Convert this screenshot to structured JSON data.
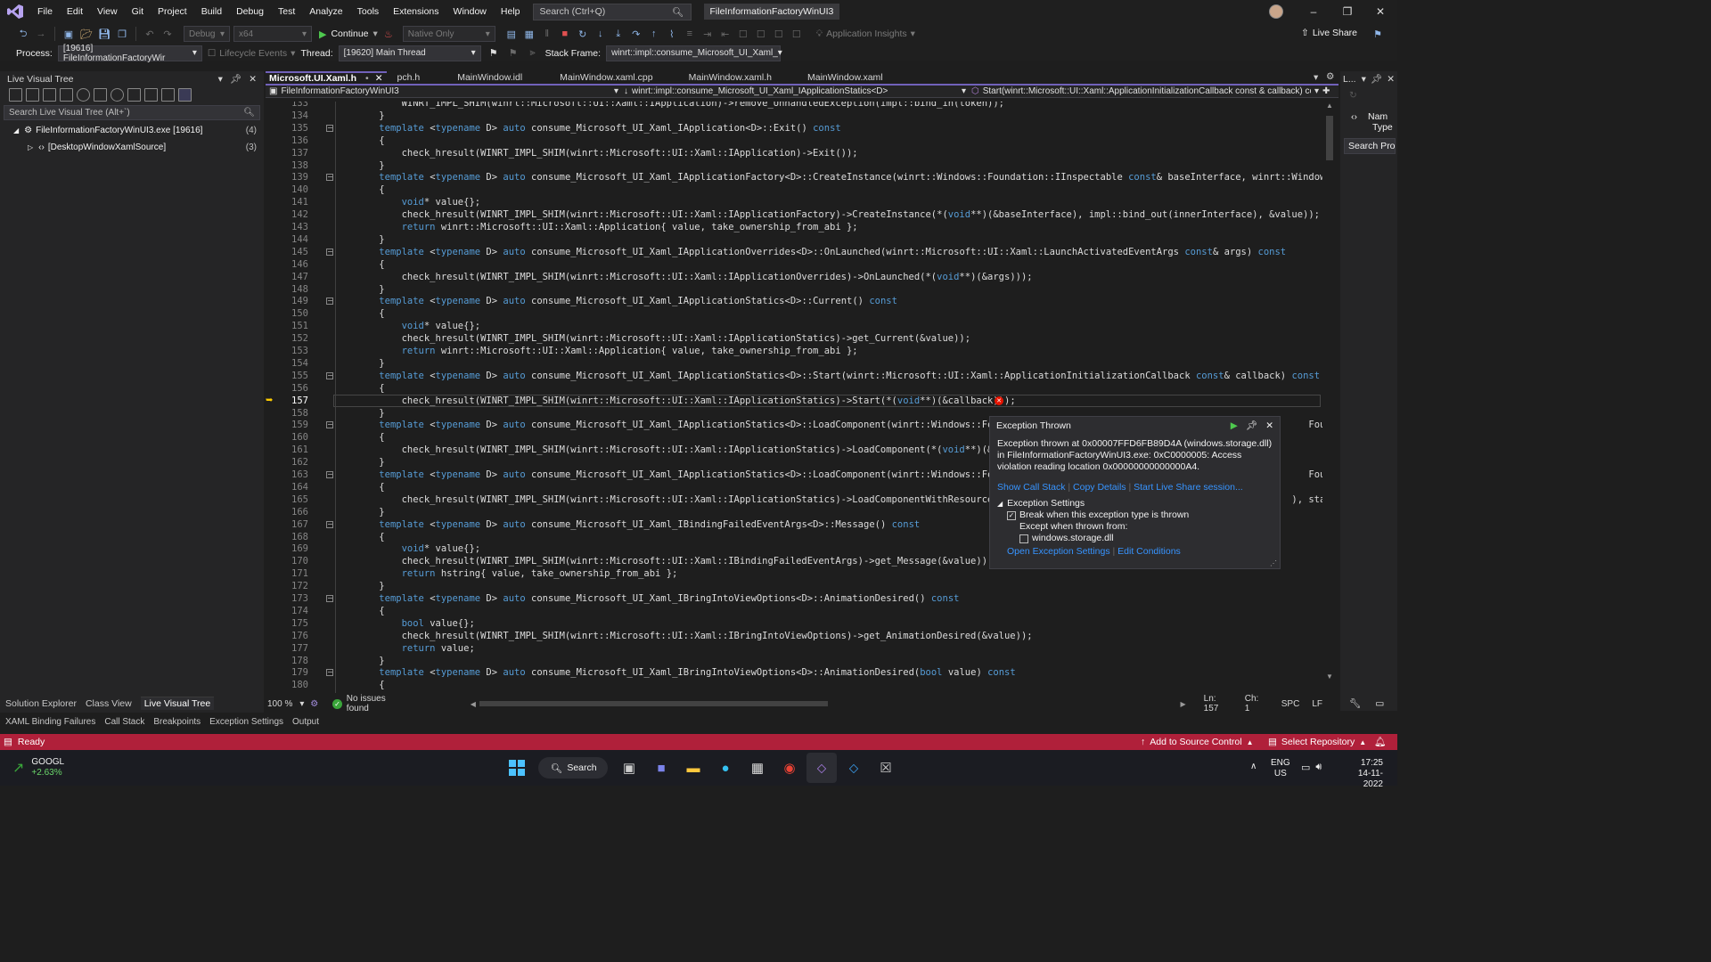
{
  "menubar": {
    "items": [
      "File",
      "Edit",
      "View",
      "Git",
      "Project",
      "Build",
      "Debug",
      "Test",
      "Analyze",
      "Tools",
      "Extensions",
      "Window",
      "Help"
    ],
    "search_placeholder": "Search (Ctrl+Q)",
    "solution_title": "FileInformationFactoryWinUI3"
  },
  "toolbar": {
    "config": "Debug",
    "platform": "x64",
    "continue_label": "Continue",
    "debugger_type": "Native Only",
    "app_insights": "Application Insights",
    "live_share": "Live Share"
  },
  "debugbar": {
    "process_label": "Process:",
    "process_value": "[19616] FileInformationFactoryWir",
    "lifecycle": "Lifecycle Events",
    "thread_label": "Thread:",
    "thread_value": "[19620] Main Thread",
    "stack_label": "Stack Frame:",
    "stack_value": "winrt::impl::consume_Microsoft_UI_Xaml_"
  },
  "live_tree": {
    "title": "Live Visual Tree",
    "search_placeholder": "Search Live Visual Tree (Alt+`)",
    "nodes": [
      {
        "label": "FileInformationFactoryWinUI3.exe [19616]",
        "count": "(4)"
      },
      {
        "label": "[DesktopWindowXamlSource]",
        "count": "(3)"
      }
    ],
    "bottom_tabs": [
      "Solution Explorer",
      "Class View",
      "Live Visual Tree"
    ]
  },
  "editor": {
    "tabs": [
      "Microsoft.UI.Xaml.h",
      "pch.h",
      "MainWindow.idl",
      "MainWindow.xaml.cpp",
      "MainWindow.xaml.h",
      "MainWindow.xaml"
    ],
    "nav_project": "FileInformationFactoryWinUI3",
    "nav_scope": "winrt::impl::consume_Microsoft_UI_Xaml_IApplicationStatics<D>",
    "nav_member": "Start(winrt::Microsoft::UI::Xaml::ApplicationInitializationCallback const & callback) cc",
    "zoom": "100 %",
    "issues": "No issues found",
    "position": {
      "ln": "Ln: 157",
      "ch": "Ch: 1",
      "spc": "SPC",
      "lf": "LF"
    },
    "current_line": 157,
    "lines": [
      {
        "n": "133",
        "t": "        WINRT_IMPL_SHIM(winrt::Microsoft::UI::Xaml::IApplication)->remove_UnhandledException(impl::bind_in(token));"
      },
      {
        "n": "134",
        "t": "    }"
      },
      {
        "n": "135",
        "t": "    template <typename D> auto consume_Microsoft_UI_Xaml_IApplication<D>::Exit() const"
      },
      {
        "n": "136",
        "t": "    {"
      },
      {
        "n": "137",
        "t": "        check_hresult(WINRT_IMPL_SHIM(winrt::Microsoft::UI::Xaml::IApplication)->Exit());"
      },
      {
        "n": "138",
        "t": "    }"
      },
      {
        "n": "139",
        "t": "    template <typename D> auto consume_Microsoft_UI_Xaml_IApplicationFactory<D>::CreateInstance(winrt::Windows::Foundation::IInspectable const& baseInterface, winrt::Windows::Fou"
      },
      {
        "n": "140",
        "t": "    {"
      },
      {
        "n": "141",
        "t": "        void* value{};"
      },
      {
        "n": "142",
        "t": "        check_hresult(WINRT_IMPL_SHIM(winrt::Microsoft::UI::Xaml::IApplicationFactory)->CreateInstance(*(void**)(&baseInterface), impl::bind_out(innerInterface), &value));"
      },
      {
        "n": "143",
        "t": "        return winrt::Microsoft::UI::Xaml::Application{ value, take_ownership_from_abi };"
      },
      {
        "n": "144",
        "t": "    }"
      },
      {
        "n": "145",
        "t": "    template <typename D> auto consume_Microsoft_UI_Xaml_IApplicationOverrides<D>::OnLaunched(winrt::Microsoft::UI::Xaml::LaunchActivatedEventArgs const& args) const"
      },
      {
        "n": "146",
        "t": "    {"
      },
      {
        "n": "147",
        "t": "        check_hresult(WINRT_IMPL_SHIM(winrt::Microsoft::UI::Xaml::IApplicationOverrides)->OnLaunched(*(void**)(&args)));"
      },
      {
        "n": "148",
        "t": "    }"
      },
      {
        "n": "149",
        "t": "    template <typename D> auto consume_Microsoft_UI_Xaml_IApplicationStatics<D>::Current() const"
      },
      {
        "n": "150",
        "t": "    {"
      },
      {
        "n": "151",
        "t": "        void* value{};"
      },
      {
        "n": "152",
        "t": "        check_hresult(WINRT_IMPL_SHIM(winrt::Microsoft::UI::Xaml::IApplicationStatics)->get_Current(&value));"
      },
      {
        "n": "153",
        "t": "        return winrt::Microsoft::UI::Xaml::Application{ value, take_ownership_from_abi };"
      },
      {
        "n": "154",
        "t": "    }"
      },
      {
        "n": "155",
        "t": "    template <typename D> auto consume_Microsoft_UI_Xaml_IApplicationStatics<D>::Start(winrt::Microsoft::UI::Xaml::ApplicationInitializationCallback const& callback) const"
      },
      {
        "n": "156",
        "t": "    {"
      },
      {
        "n": "157",
        "t": "        check_hresult(WINRT_IMPL_SHIM(winrt::Microsoft::UI::Xaml::IApplicationStatics)->Start(*(void**)(&callback)));"
      },
      {
        "n": "158",
        "t": "    }"
      },
      {
        "n": "159",
        "t": "    template <typename D> auto consume_Microsoft_UI_Xaml_IApplicationStatics<D>::LoadComponent(winrt::Windows::Foundat                                                   Foundati"
      },
      {
        "n": "160",
        "t": "    {"
      },
      {
        "n": "161",
        "t": "        check_hresult(WINRT_IMPL_SHIM(winrt::Microsoft::UI::Xaml::IApplicationStatics)->LoadComponent(*(void**)(&compo"
      },
      {
        "n": "162",
        "t": "    }"
      },
      {
        "n": "163",
        "t": "    template <typename D> auto consume_Microsoft_UI_Xaml_IApplicationStatics<D>::LoadComponent(winrt::Windows::Foundat                                                   Foundati"
      },
      {
        "n": "164",
        "t": "    {"
      },
      {
        "n": "165",
        "t": "        check_hresult(WINRT_IMPL_SHIM(winrt::Microsoft::UI::Xaml::IApplicationStatics)->LoadComponentWithResourceLocat                                                ), stat"
      },
      {
        "n": "166",
        "t": "    }"
      },
      {
        "n": "167",
        "t": "    template <typename D> auto consume_Microsoft_UI_Xaml_IBindingFailedEventArgs<D>::Message() const"
      },
      {
        "n": "168",
        "t": "    {"
      },
      {
        "n": "169",
        "t": "        void* value{};"
      },
      {
        "n": "170",
        "t": "        check_hresult(WINRT_IMPL_SHIM(winrt::Microsoft::UI::Xaml::IBindingFailedEventArgs)->get_Message(&value));"
      },
      {
        "n": "171",
        "t": "        return hstring{ value, take_ownership_from_abi };"
      },
      {
        "n": "172",
        "t": "    }"
      },
      {
        "n": "173",
        "t": "    template <typename D> auto consume_Microsoft_UI_Xaml_IBringIntoViewOptions<D>::AnimationDesired() const"
      },
      {
        "n": "174",
        "t": "    {"
      },
      {
        "n": "175",
        "t": "        bool value{};"
      },
      {
        "n": "176",
        "t": "        check_hresult(WINRT_IMPL_SHIM(winrt::Microsoft::UI::Xaml::IBringIntoViewOptions)->get_AnimationDesired(&value));"
      },
      {
        "n": "177",
        "t": "        return value;"
      },
      {
        "n": "178",
        "t": "    }"
      },
      {
        "n": "179",
        "t": "    template <typename D> auto consume_Microsoft_UI_Xaml_IBringIntoViewOptions<D>::AnimationDesired(bool value) const"
      },
      {
        "n": "180",
        "t": "    {"
      },
      {
        "n": "181",
        "t": "        check_hresult(WINRT_IMPL_SHIM(winrt::Microsoft::UI::Xaml::IBringIntoViewOptions)->put_AnimationDesired(value));"
      }
    ]
  },
  "exception": {
    "title": "Exception Thrown",
    "message": "Exception thrown at 0x00007FFD6FB89D4A (windows.storage.dll) in FileInformationFactoryWinUI3.exe: 0xC0000005: Access violation reading location 0x00000000000000A4.",
    "links": [
      "Show Call Stack",
      "Copy Details",
      "Start Live Share session..."
    ],
    "settings_title": "Exception Settings",
    "break_label": "Break when this exception type is thrown",
    "except_label": "Except when thrown from:",
    "dll_label": "windows.storage.dll",
    "bottom_links": [
      "Open Exception Settings",
      "Edit Conditions"
    ]
  },
  "right_pane": {
    "title": "L...",
    "name": "Nam",
    "type": "Type",
    "search": "Search Pro"
  },
  "bottom_tabs": [
    "XAML Binding Failures",
    "Call Stack",
    "Breakpoints",
    "Exception Settings",
    "Output"
  ],
  "status": {
    "ready": "Ready",
    "source_control": "Add to Source Control",
    "repo": "Select Repository",
    "accent": "#b0203a"
  },
  "taskbar": {
    "stock_symbol": "GOOGL",
    "stock_change": "+2.63%",
    "search": "Search",
    "lang1": "ENG",
    "lang2": "US",
    "time": "17:25",
    "date": "14-11-2022"
  }
}
